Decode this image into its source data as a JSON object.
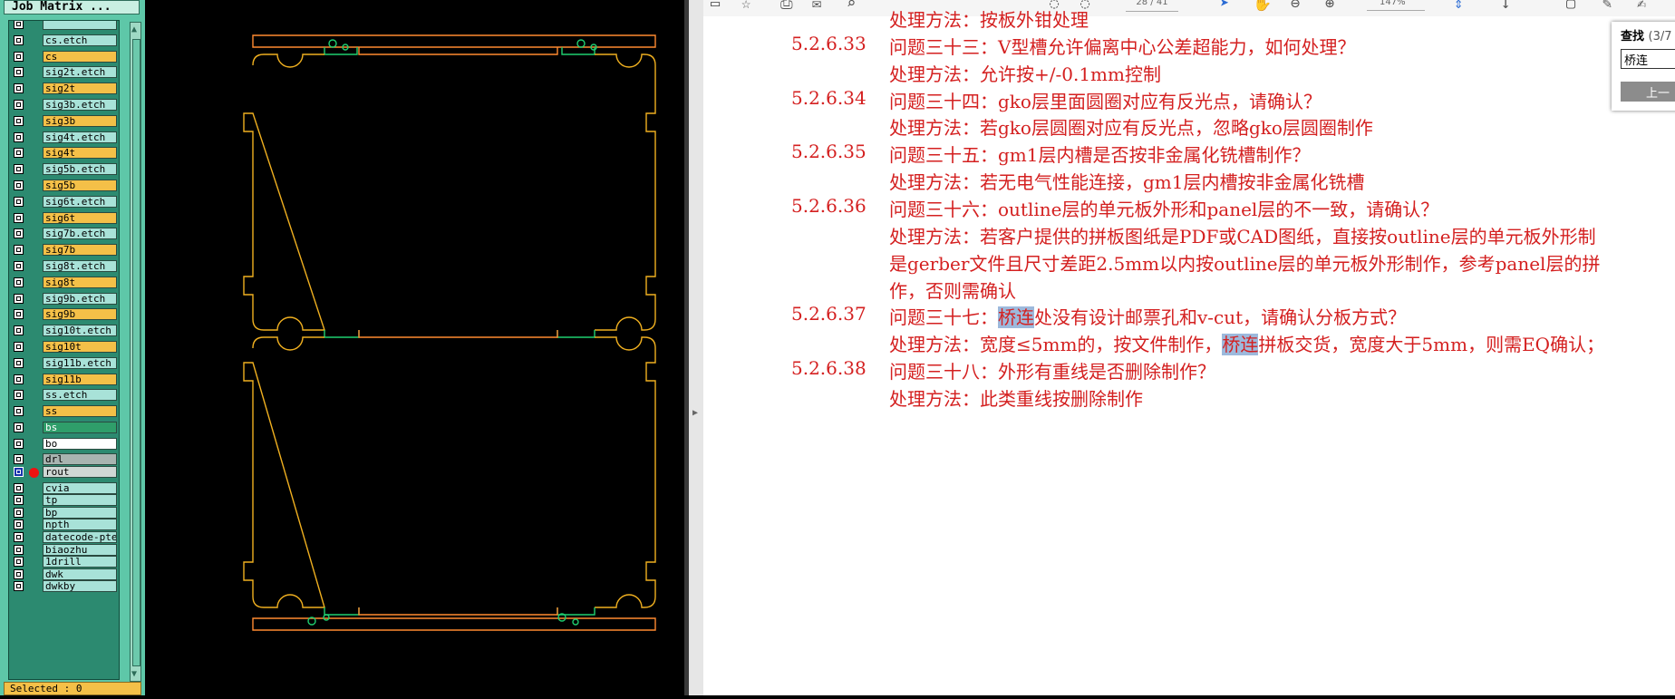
{
  "panel": {
    "title": "Job Matrix ...",
    "layers": [
      {
        "name": "",
        "color": "c-teal"
      },
      {
        "name": "cs.etch",
        "color": "c-teal"
      },
      {
        "name": "cs",
        "color": "c-orange"
      },
      {
        "name": "sig2t.etch",
        "color": "c-teal"
      },
      {
        "name": "sig2t",
        "color": "c-orange"
      },
      {
        "name": "sig3b.etch",
        "color": "c-teal"
      },
      {
        "name": "sig3b",
        "color": "c-orange"
      },
      {
        "name": "sig4t.etch",
        "color": "c-teal"
      },
      {
        "name": "sig4t",
        "color": "c-orange"
      },
      {
        "name": "sig5b.etch",
        "color": "c-teal"
      },
      {
        "name": "sig5b",
        "color": "c-orange"
      },
      {
        "name": "sig6t.etch",
        "color": "c-teal"
      },
      {
        "name": "sig6t",
        "color": "c-orange"
      },
      {
        "name": "sig7b.etch",
        "color": "c-teal"
      },
      {
        "name": "sig7b",
        "color": "c-orange"
      },
      {
        "name": "sig8t.etch",
        "color": "c-teal"
      },
      {
        "name": "sig8t",
        "color": "c-orange"
      },
      {
        "name": "sig9b.etch",
        "color": "c-teal"
      },
      {
        "name": "sig9b",
        "color": "c-orange"
      },
      {
        "name": "sig10t.etch",
        "color": "c-teal"
      },
      {
        "name": "sig10t",
        "color": "c-orange"
      },
      {
        "name": "sig11b.etch",
        "color": "c-teal"
      },
      {
        "name": "sig11b",
        "color": "c-orange"
      },
      {
        "name": "ss.etch",
        "color": "c-teal"
      },
      {
        "name": "ss",
        "color": "c-orange"
      },
      {
        "name": "bs",
        "color": "c-green"
      },
      {
        "name": "bo",
        "color": "c-white"
      },
      {
        "name": "drl",
        "color": "c-gray"
      },
      {
        "name": "rout",
        "color": "c-lt",
        "selected": true
      },
      {
        "name": "cvia",
        "color": "c-teal"
      },
      {
        "name": "tp",
        "color": "c-teal"
      },
      {
        "name": "bp",
        "color": "c-teal"
      },
      {
        "name": "npth",
        "color": "c-teal"
      },
      {
        "name": "datecode-pte",
        "color": "c-teal"
      },
      {
        "name": "biaozhu",
        "color": "c-teal"
      },
      {
        "name": "1drill",
        "color": "c-teal"
      },
      {
        "name": "dwk",
        "color": "c-teal"
      },
      {
        "name": "dwkby",
        "color": "c-teal"
      }
    ],
    "status": "Selected : 0"
  },
  "pdf": {
    "page_value": "28 / 41",
    "zoom_value": "147%",
    "lines": [
      {
        "type": "a",
        "text": "处理方法：按板外钳处理"
      },
      {
        "type": "q",
        "num": "5.2.6.33",
        "text": "问题三十三：V型槽允许偏离中心公差超能力，如何处理？"
      },
      {
        "type": "a",
        "text": "处理方法：允许按+/-0.1mm控制"
      },
      {
        "type": "q",
        "num": "5.2.6.34",
        "text": "问题三十四：gko层里面圆圈对应有反光点，请确认？"
      },
      {
        "type": "a",
        "text": "处理方法：若gko层圆圈对应有反光点，忽略gko层圆圈制作"
      },
      {
        "type": "q",
        "num": "5.2.6.35",
        "text": "问题三十五：gm1层内槽是否按非金属化铣槽制作？"
      },
      {
        "type": "a",
        "text": "处理方法：若无电气性能连接，gm1层内槽按非金属化铣槽"
      },
      {
        "type": "q",
        "num": "5.2.6.36",
        "text": "问题三十六：outline层的单元板外形和panel层的不一致，请确认？"
      },
      {
        "type": "a",
        "text": "处理方法：若客户提供的拼板图纸是PDF或CAD图纸，直接按outline层的单元板外形制"
      },
      {
        "type": "a",
        "text": "是gerber文件且尺寸差距2.5mm以内按outline层的单元板外形制作，参考panel层的拼"
      },
      {
        "type": "a",
        "text": "作，否则需确认"
      },
      {
        "type": "q",
        "num": "5.2.6.37",
        "pre": "问题三十七：",
        "hl": "桥连",
        "post": "处没有设计邮票孔和v-cut，请确认分板方式？"
      },
      {
        "type": "a",
        "pre": "处理方法：宽度≤5mm的，按文件制作，",
        "hl": "桥连",
        "post": "拼板交货，宽度大于5mm，则需EQ确认；"
      },
      {
        "type": "q",
        "num": "5.2.6.38",
        "text": "问题三十八：外形有重线是否删除制作？"
      },
      {
        "type": "a",
        "text": "处理方法：此类重线按删除制作"
      }
    ]
  },
  "find": {
    "title": "查找",
    "count": "(3/7",
    "query": "桥连",
    "prev_label": "上一"
  },
  "colors": {
    "outline": "#f0b020",
    "tab_orange": "#ff8a30",
    "bridge_green": "#1fd070",
    "pdf_text": "#d42020",
    "highlight": "#9db9dc"
  }
}
